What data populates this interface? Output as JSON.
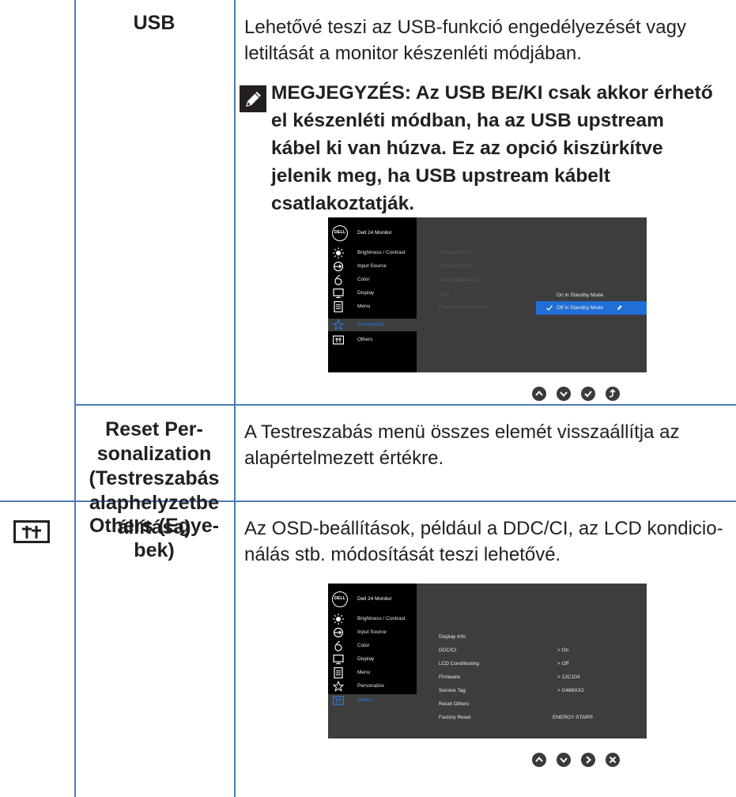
{
  "usb": {
    "setting": "USB",
    "description": "Lehetővé teszi az USB-funkció engedélyezését vagy letiltását a monitor készenléti módjában.",
    "note": "MEGJEGYZÉS: Az USB BE/KI csak akkor érhető el készenléti módban, ha az USB upstream kábel ki van húzva. Ez az opció kiszürkítve jelenik meg, ha USB upstream kábelt csatlakoztatják."
  },
  "reset_personalization": {
    "setting": "Reset Per-sonalization (Testreszabás alaphelyzetbe állítása)",
    "description": "A Testreszabás menü összes elemét visszaállítja az alapértelmezett értékre."
  },
  "others": {
    "setting": "Others (Egye-bek)",
    "description": "Az OSD-beállítások, például a DDC/CI, az LCD kondicio-nálás stb. módosítását teszi lehetővé."
  },
  "osd": {
    "logo": "DELL",
    "title": "Dell 24 Monitor",
    "menu": [
      {
        "label": "Brightness / Contrast",
        "icon": "brightness-icon"
      },
      {
        "label": "Input Source",
        "icon": "input-source-icon"
      },
      {
        "label": "Color",
        "icon": "color-icon"
      },
      {
        "label": "Display",
        "icon": "display-icon"
      },
      {
        "label": "Menu",
        "icon": "menu-icon"
      },
      {
        "label": "Personalize",
        "icon": "star-icon"
      },
      {
        "label": "Others",
        "icon": "others-icon"
      }
    ],
    "personalize_submenu": [
      "Shortcut Key 1",
      "Shortcut Key 2",
      "Power Button LED",
      "USB",
      "Reset Personalization"
    ],
    "usb_options": [
      "On in Standby Mode",
      "Off in Standby Mode"
    ],
    "others_submenu": [
      "Display Info",
      "DDC/CI",
      "LCD Conditioning",
      "Firmware",
      "Service Tag",
      "Reset Others",
      "Factory Reset"
    ],
    "others_values": [
      "> On",
      "> Off",
      "> 12C104",
      "> G469XX2",
      "ENERGY STAR®"
    ]
  },
  "accent_color": "#2a7de1",
  "border_color": "#4a7bb7"
}
